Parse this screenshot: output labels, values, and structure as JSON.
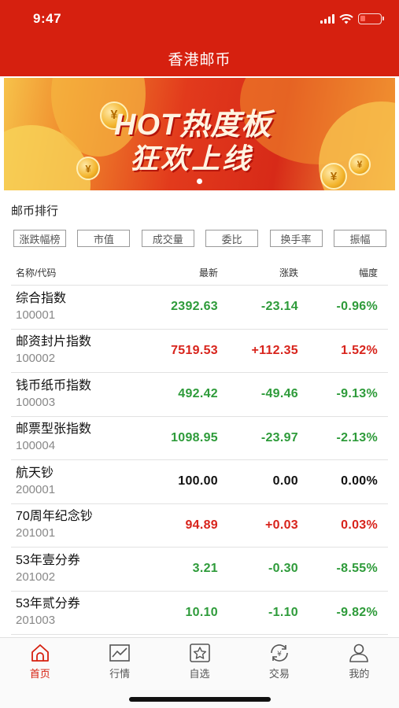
{
  "status": {
    "time": "9:47"
  },
  "header": {
    "title": "香港邮币"
  },
  "banner": {
    "line1": "HOT热度板",
    "line2": "狂欢上线"
  },
  "section": {
    "title": "邮币排行"
  },
  "filters": [
    "涨跌幅榜",
    "市值",
    "成交量",
    "委比",
    "换手率",
    "振幅"
  ],
  "table": {
    "headers": {
      "name": "名称/代码",
      "last": "最新",
      "change": "涨跌",
      "pct": "幅度"
    },
    "rows": [
      {
        "name": "综合指数",
        "code": "100001",
        "last": "2392.63",
        "change": "-23.14",
        "pct": "-0.96%",
        "trend": "down"
      },
      {
        "name": "邮资封片指数",
        "code": "100002",
        "last": "7519.53",
        "change": "+112.35",
        "pct": "1.52%",
        "trend": "up"
      },
      {
        "name": "钱币纸币指数",
        "code": "100003",
        "last": "492.42",
        "change": "-49.46",
        "pct": "-9.13%",
        "trend": "down"
      },
      {
        "name": "邮票型张指数",
        "code": "100004",
        "last": "1098.95",
        "change": "-23.97",
        "pct": "-2.13%",
        "trend": "down"
      },
      {
        "name": "航天钞",
        "code": "200001",
        "last": "100.00",
        "change": "0.00",
        "pct": "0.00%",
        "trend": "flat"
      },
      {
        "name": "70周年纪念钞",
        "code": "201001",
        "last": "94.89",
        "change": "+0.03",
        "pct": "0.03%",
        "trend": "up"
      },
      {
        "name": "53年壹分券",
        "code": "201002",
        "last": "3.21",
        "change": "-0.30",
        "pct": "-8.55%",
        "trend": "down"
      },
      {
        "name": "53年贰分券",
        "code": "201003",
        "last": "10.10",
        "change": "-1.10",
        "pct": "-9.82%",
        "trend": "down"
      }
    ]
  },
  "tabbar": {
    "tabs": [
      {
        "label": "首页",
        "icon": "home-icon",
        "active": true
      },
      {
        "label": "行情",
        "icon": "chart-icon",
        "active": false
      },
      {
        "label": "自选",
        "icon": "star-icon",
        "active": false
      },
      {
        "label": "交易",
        "icon": "exchange-icon",
        "active": false
      },
      {
        "label": "我的",
        "icon": "user-icon",
        "active": false
      }
    ]
  },
  "colors": {
    "brand": "#d6200f",
    "up": "#d8241c",
    "down": "#2e9b3a",
    "flat": "#111111"
  }
}
